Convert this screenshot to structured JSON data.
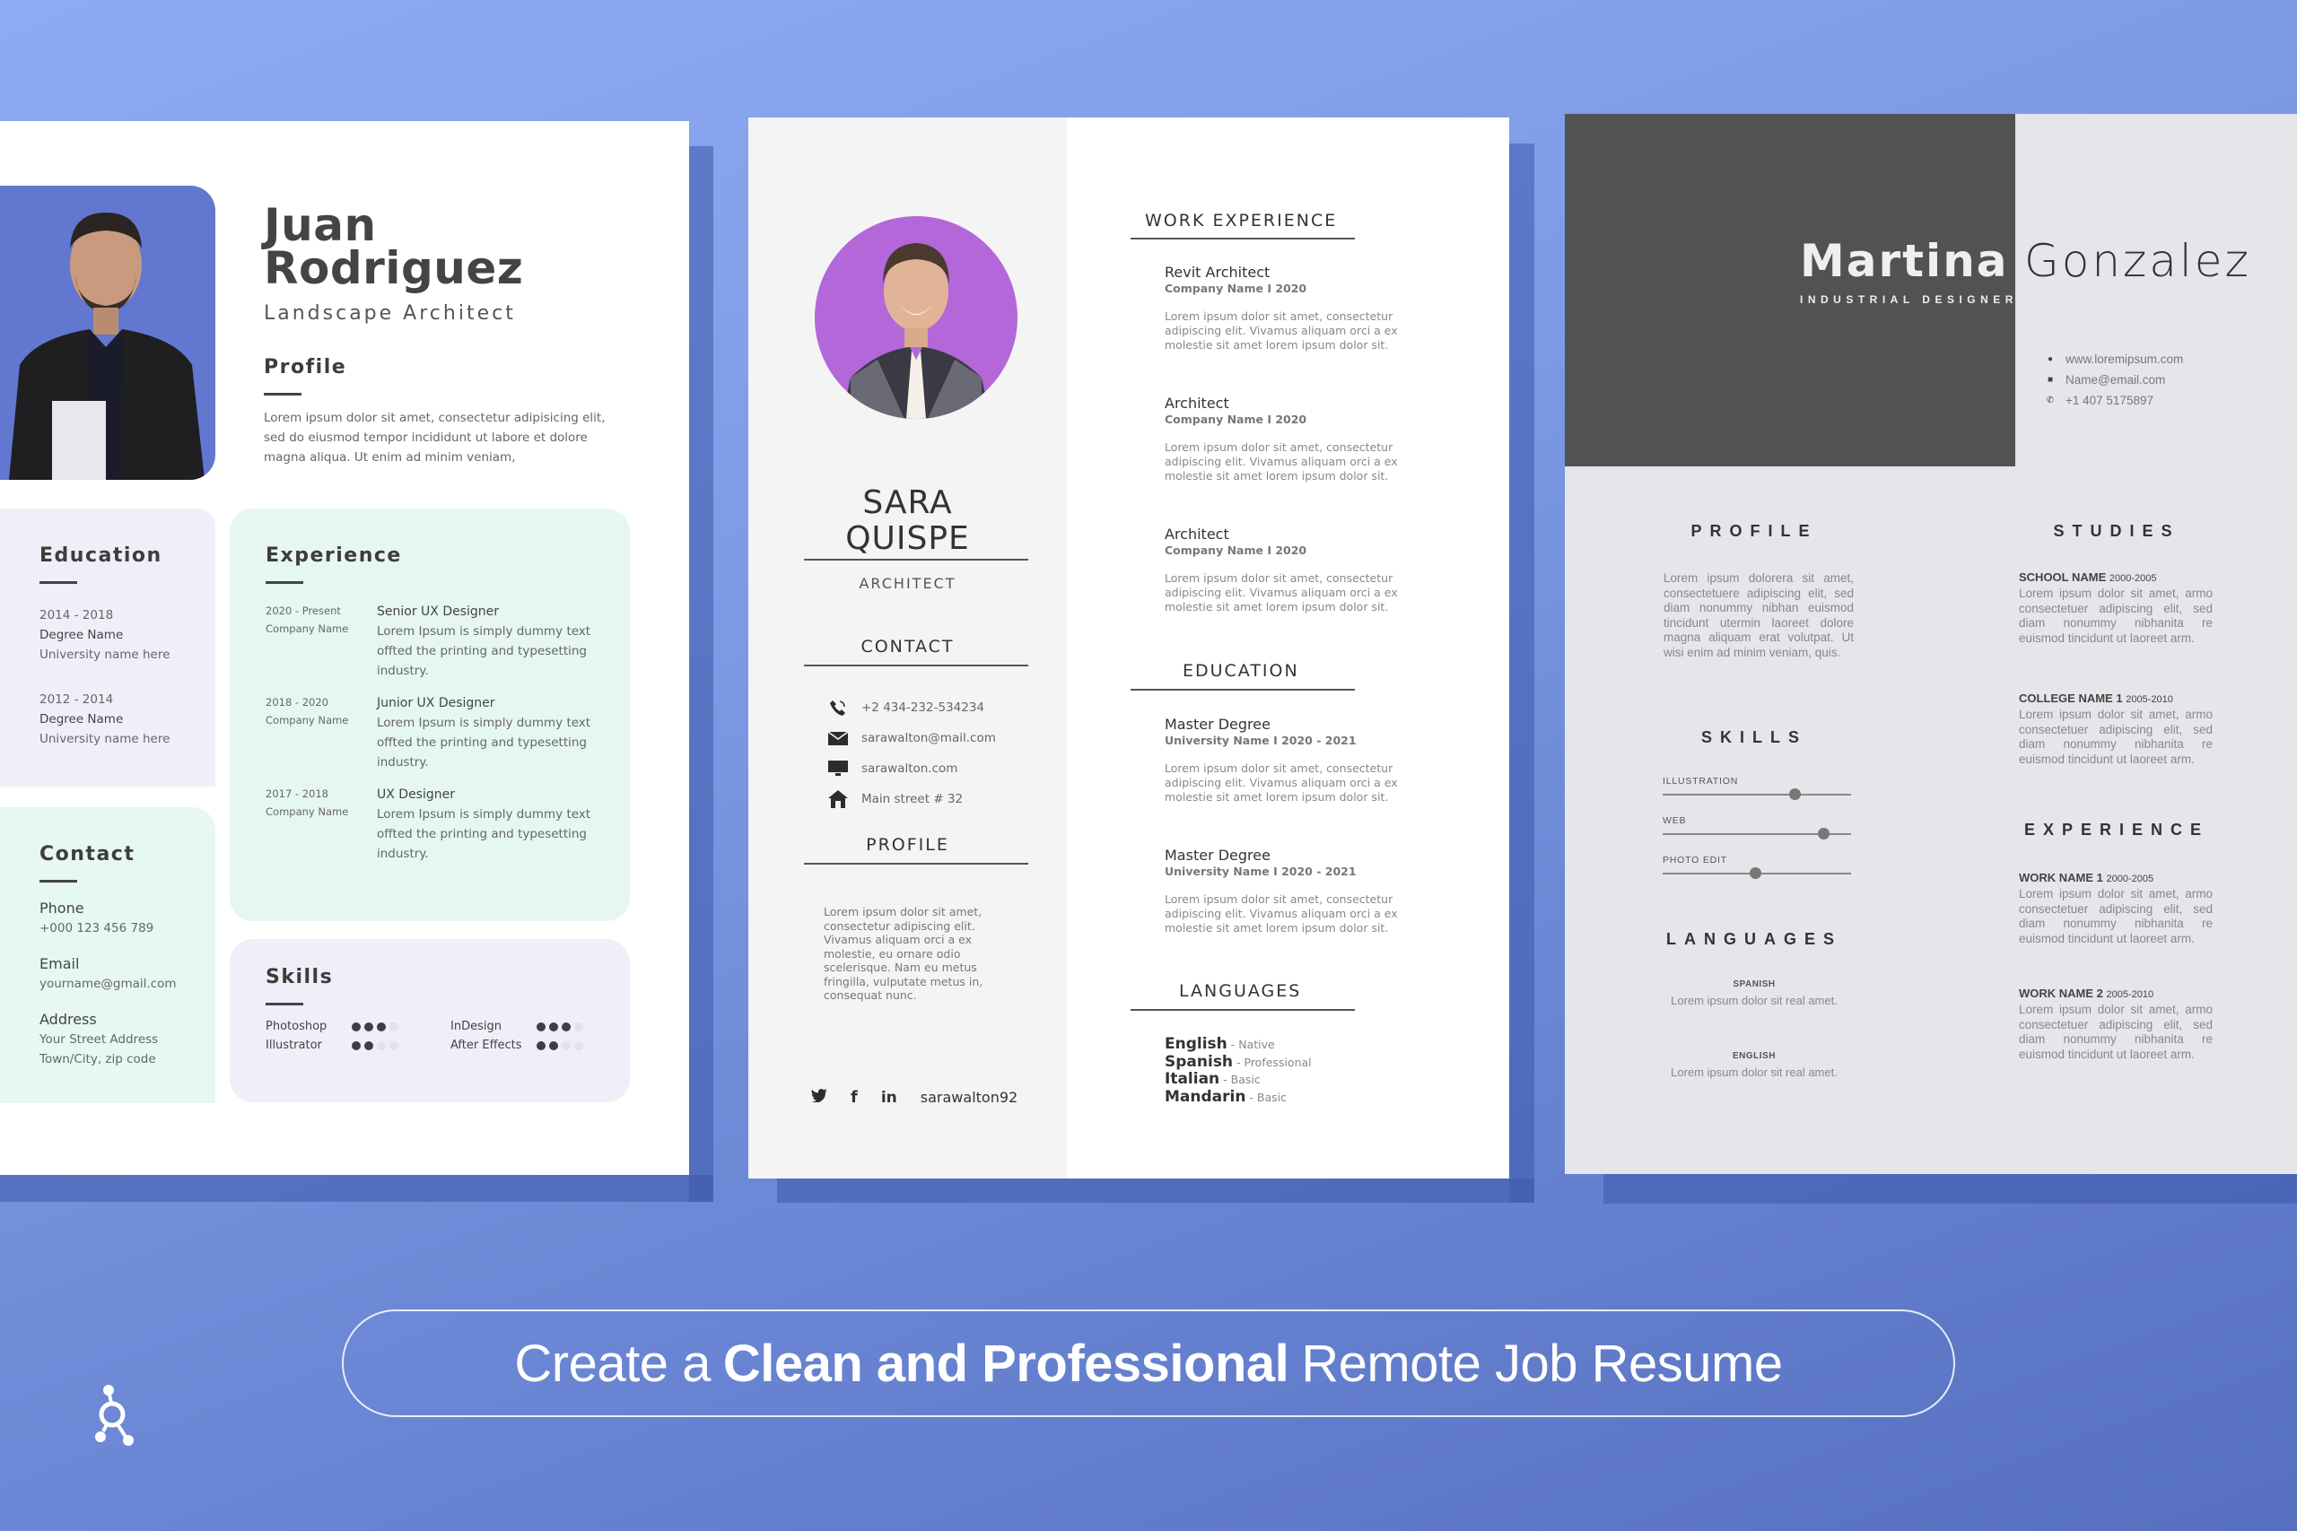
{
  "resume1": {
    "first_name": "Juan",
    "last_name": "Rodriguez",
    "role": "Landscape Architect",
    "profile": {
      "heading": "Profile",
      "text": "Lorem ipsum dolor sit amet, consectetur adipisicing elit, sed do eiusmod tempor incididunt ut labore et dolore magna aliqua. Ut enim ad minim veniam,"
    },
    "education": {
      "heading": "Education",
      "items": [
        {
          "years": "2014 - 2018",
          "degree": "Degree Name",
          "school": "University name here"
        },
        {
          "years": "2012 - 2014",
          "degree": "Degree Name",
          "school": "University name here"
        }
      ]
    },
    "experience": {
      "heading": "Experience",
      "items": [
        {
          "years": "2020 - Present",
          "company": "Company Name",
          "title": "Senior UX Designer",
          "desc": "Lorem Ipsum is simply dummy text offted the printing and typesetting industry."
        },
        {
          "years": "2018 - 2020",
          "company": "Company Name",
          "title": "Junior UX Designer",
          "desc": "Lorem Ipsum is simply dummy text offted the printing and typesetting industry."
        },
        {
          "years": "2017 - 2018",
          "company": "Company Name",
          "title": "UX Designer",
          "desc": "Lorem Ipsum is simply dummy text offted the printing and typesetting industry."
        }
      ]
    },
    "contact": {
      "heading": "Contact",
      "phone_label": "Phone",
      "phone": "+000 123 456 789",
      "email_label": "Email",
      "email": "yourname@gmail.com",
      "address_label": "Address",
      "address_line1": "Your Street Address",
      "address_line2": "Town/City, zip code"
    },
    "skills": {
      "heading": "Skills",
      "items": [
        {
          "name": "Photoshop",
          "level": 3,
          "max": 4
        },
        {
          "name": "InDesign",
          "level": 3,
          "max": 4
        },
        {
          "name": "Illustrator",
          "level": 2,
          "max": 4
        },
        {
          "name": "After Effects",
          "level": 2,
          "max": 4
        }
      ]
    },
    "photo_bg": "#6277cf"
  },
  "resume2": {
    "first_name": "SARA",
    "last_name": "QUISPE",
    "role": "ARCHITECT",
    "contact": {
      "heading": "CONTACT",
      "items": [
        {
          "icon": "phone-icon",
          "text": "+2 434-232-534234"
        },
        {
          "icon": "mail-icon",
          "text": "sarawalton@mail.com"
        },
        {
          "icon": "monitor-icon",
          "text": "sarawalton.com"
        },
        {
          "icon": "home-icon",
          "text": "Main street # 32"
        }
      ]
    },
    "profile": {
      "heading": "PROFILE",
      "text": "Lorem ipsum dolor sit amet, consectetur adipiscing elit. Vivamus aliquam orci a ex molestie, eu ornare odio scelerisque. Nam eu metus fringilla, vulputate metus in, consequat nunc."
    },
    "social": {
      "handle": "sarawalton92",
      "icons": [
        "twitter-icon",
        "facebook-icon",
        "linkedin-icon"
      ]
    },
    "work": {
      "heading": "WORK EXPERIENCE",
      "items": [
        {
          "title": "Revit Architect",
          "sub": "Company Name  I  2020",
          "desc": "Lorem ipsum dolor sit amet, consectetur adipiscing elit. Vivamus aliquam orci a ex molestie sit amet lorem ipsum dolor sit."
        },
        {
          "title": "Architect",
          "sub": "Company Name  I  2020",
          "desc": "Lorem ipsum dolor sit amet, consectetur adipiscing elit. Vivamus aliquam orci a ex molestie sit amet lorem ipsum dolor sit."
        },
        {
          "title": "Architect",
          "sub": "Company Name  I  2020",
          "desc": "Lorem ipsum dolor sit amet, consectetur adipiscing elit. Vivamus aliquam orci a ex molestie sit amet lorem ipsum dolor sit."
        }
      ]
    },
    "education": {
      "heading": "EDUCATION",
      "items": [
        {
          "title": "Master Degree",
          "sub": "University Name  I  2020 - 2021",
          "desc": "Lorem ipsum dolor sit amet, consectetur adipiscing elit. Vivamus aliquam orci a ex molestie sit amet lorem ipsum dolor sit."
        },
        {
          "title": "Master Degree",
          "sub": "University Name  I  2020 - 2021",
          "desc": "Lorem ipsum dolor sit amet, consectetur adipiscing elit. Vivamus aliquam orci a ex molestie sit amet lorem ipsum dolor sit."
        }
      ]
    },
    "languages": {
      "heading": "LANGUAGES",
      "items": [
        {
          "name": "English",
          "level": " - Native"
        },
        {
          "name": "Spanish",
          "level": " - Professional"
        },
        {
          "name": "Italian",
          "level": " - Basic"
        },
        {
          "name": "Mandarin",
          "level": " - Basic"
        }
      ]
    },
    "photo_bg": "#b467d8"
  },
  "resume3": {
    "first_name": "Martina",
    "last_name": "Gonzalez",
    "role": "INDUSTRIAL DESIGNER",
    "contacts": [
      {
        "icon": "globe-icon",
        "text": "www.loremipsum.com"
      },
      {
        "icon": "mail-icon",
        "text": "Name@email.com"
      },
      {
        "icon": "phone-icon",
        "text": "+1 407 5175897"
      }
    ],
    "profile": {
      "heading": "PROFILE",
      "text": "Lorem ipsum dolorera sit amet, consectetuere adipiscing elit, sed diam nonummy nibhan euismod tincidunt utermin laoreet dolore magna aliquam erat volutpat. Ut wisi enim ad minim veniam, quis."
    },
    "skills": {
      "heading": "SKILLS",
      "items": [
        {
          "name": "ILLUSTRATION",
          "level": 0.7
        },
        {
          "name": "WEB",
          "level": 0.85
        },
        {
          "name": "PHOTO EDIT",
          "level": 0.49
        }
      ]
    },
    "languages": {
      "heading": "LANGUAGES",
      "items": [
        {
          "name": "SPANISH",
          "desc": "Lorem ipsum dolor sit real amet."
        },
        {
          "name": "ENGLISH",
          "desc": "Lorem ipsum dolor sit real amet."
        }
      ]
    },
    "studies": {
      "heading": "STUDIES",
      "items": [
        {
          "name": "SCHOOL NAME",
          "years": "2000-2005",
          "desc": "Lorem ipsum dolor sit amet, armo consectetuer adipiscing elit, sed diam nonummy nibhanita re euismod tincidunt ut laoreet arm."
        },
        {
          "name": "COLLEGE NAME 1",
          "years": "2005-2010",
          "desc": "Lorem ipsum dolor sit amet, armo consectetuer adipiscing elit, sed diam nonummy nibhanita re euismod tincidunt ut laoreet arm."
        }
      ]
    },
    "experience": {
      "heading": "EXPERIENCE",
      "items": [
        {
          "name": "WORK NAME 1",
          "years": "2000-2005",
          "desc": "Lorem ipsum dolor sit amet, armo consectetuer adipiscing elit, sed diam nonummy nibhanita re euismod tincidunt ut laoreet arm."
        },
        {
          "name": "WORK NAME 2",
          "years": "2005-2010",
          "desc": "Lorem ipsum dolor sit amet, armo consectetuer adipiscing elit, sed diam nonummy nibhanita re euismod tincidunt ut laoreet arm."
        }
      ]
    },
    "header_bg": "#525252"
  },
  "banner": {
    "prefix": "Create a",
    "bold": "Clean and Professional",
    "suffix": "Remote Job Resume"
  },
  "logo": {
    "icon": "brand-logo-icon"
  },
  "colors": {
    "background_start": "#8eaaf2",
    "background_end": "#5670bf",
    "text_dark": "#444444"
  }
}
